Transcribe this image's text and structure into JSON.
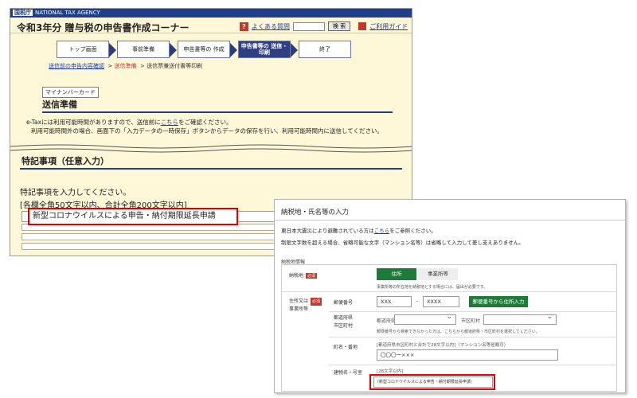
{
  "top_window": {
    "agency_bar": {
      "logo": "国税庁",
      "text": "NATIONAL TAX AGENCY"
    },
    "title": "令和3年分 贈与税の申告書作成コーナー",
    "faq_label": "よくある質問",
    "search_button": "検 索",
    "guide_label": "ご利用ガイド",
    "steps": [
      {
        "label": "トップ画面"
      },
      {
        "label": "事前準備"
      },
      {
        "label": "申告書等の 作成"
      },
      {
        "label": "申告書等の 送信・印刷"
      },
      {
        "label": "終了"
      }
    ],
    "breadcrumb": {
      "first": "送信前の申告内容確認",
      "current": "送信準備",
      "last": "送信票兼送付書等印刷"
    },
    "mynumber_button": "マイナンバーカード",
    "section1_title": "送信準備",
    "notice_line1_prefix": "e-Taxには利用可能時間がありますので、送信前に",
    "notice_line1_link": "こちら",
    "notice_line1_suffix": "をご確認ください。",
    "notice_line2": "利用可能時間外の場合、画面下の「入力データの一時保存」ボタンからデータの保存を行い、利用可能時間内に送信してください。",
    "section2_title": "特記事項（任意入力）",
    "instruction": "特記事項を入力してください。",
    "limit_note": "[各欄全角50文字以内、合計全角200文字以内]",
    "highlighted_value": "新型コロナウイルスによる申告・納付期限延長申請"
  },
  "bottom_window": {
    "title": "納税地・氏名等の入力",
    "note1_prefix": "東日本大震災により避難されている方は",
    "note1_link": "こちら",
    "note1_suffix": "をご参照ください。",
    "note2": "制限文字数を超える場合、省略可能な文字（マンション名等）は省略して入力して差し支えありません。",
    "section_label": "納税地情報",
    "nozeichi_label": "納税地",
    "required_label": "必須",
    "tab_address": "住所",
    "tab_office": "事業所等",
    "tab_note": "事業所等の所在地を納税地とする場合には、届出が必要です。",
    "address_label_line1": "住所又は",
    "address_label_line2": "事業所等",
    "postal_label": "郵便番号",
    "postal1_placeholder": "XXX",
    "postal2_placeholder": "XXXX",
    "postal_dash": "-",
    "postal_button": "郵便番号から住所入力",
    "pref_city_label_line1": "都道府県",
    "pref_city_label_line2": "市区町村",
    "pref_select_label": "都道府県",
    "city_select_label": "市区町村",
    "pref_note": "郵便番号から検索できなかった方は、こちらから都道府県・市区町村を選択してください。",
    "street_label": "町名・番地",
    "street_note": "[都道府県市区町村と合計で28文字以内]（マンション名等省略可）",
    "street_value": "〇〇〇ー×××",
    "building_label": "建物名・号室",
    "building_note": "[28文字以内]",
    "building_value": "(新型コロナウイルスによる申告・納付期限延長申請)"
  },
  "colors": {
    "highlight": "#e00000",
    "navy": "#1f3f8c",
    "green": "#1e7a38",
    "cream": "#fff8d8"
  }
}
